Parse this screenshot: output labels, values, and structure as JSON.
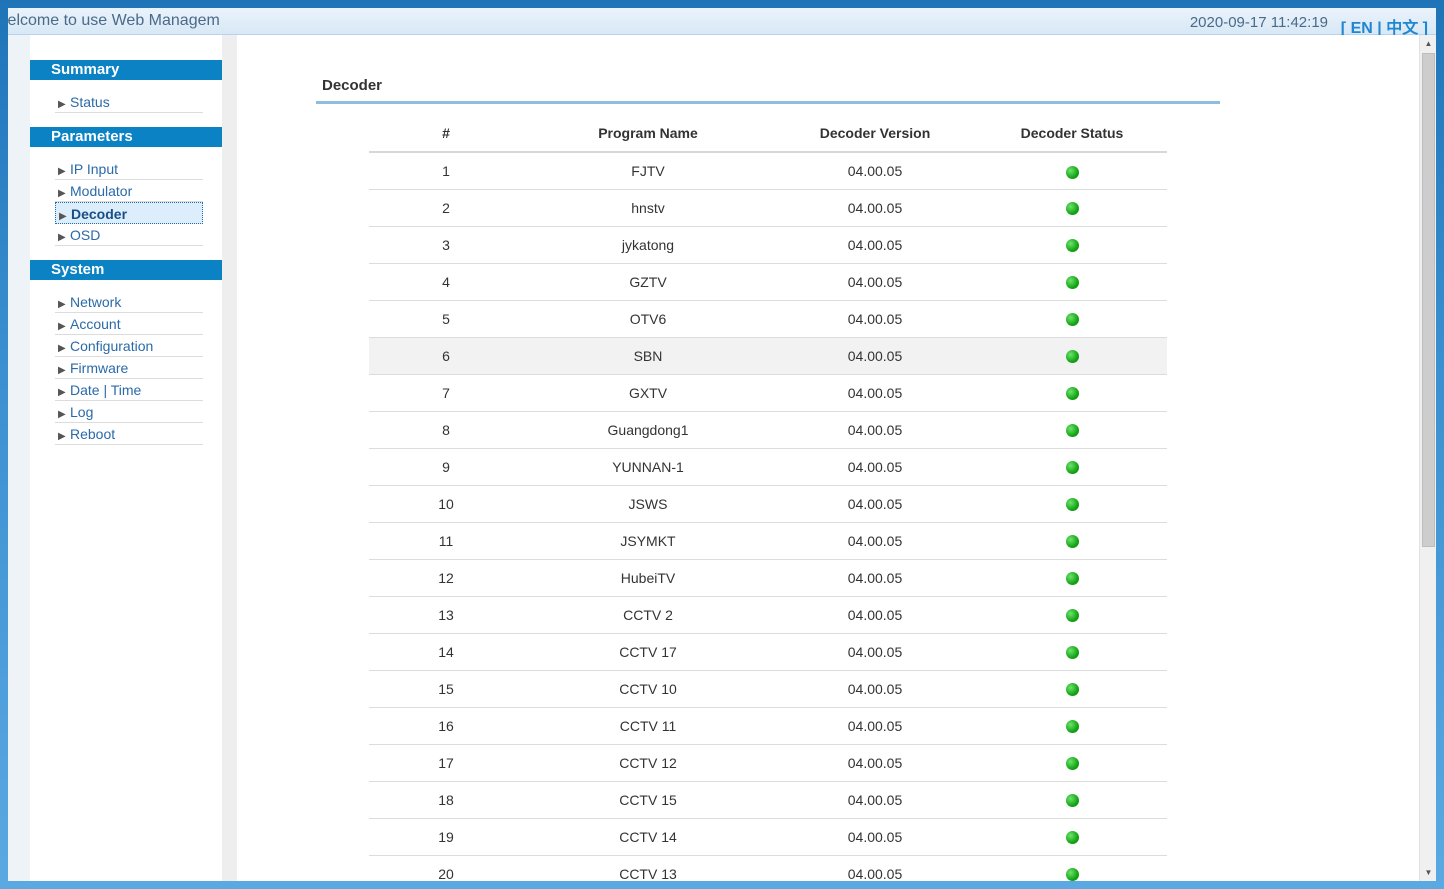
{
  "header": {
    "marquee_text": "welcome to use Web Management",
    "datetime": "2020-09-17 11:42:19",
    "lang_open": "[",
    "lang_en": "EN",
    "lang_sep": "|",
    "lang_cn": "中文",
    "lang_close": "]"
  },
  "sidebar": {
    "summary_title": "Summary",
    "summary_items": [
      "Status"
    ],
    "parameters_title": "Parameters",
    "parameters_items": [
      "IP Input",
      "Modulator",
      "Decoder",
      "OSD"
    ],
    "system_title": "System",
    "system_items": [
      "Network",
      "Account",
      "Configuration",
      "Firmware",
      "Date | Time",
      "Log",
      "Reboot"
    ],
    "active_item": "Decoder"
  },
  "panel": {
    "title": "Decoder",
    "columns": [
      "#",
      "Program Name",
      "Decoder Version",
      "Decoder Status"
    ],
    "rows": [
      {
        "num": "1",
        "name": "FJTV",
        "version": "04.00.05",
        "status": "ok"
      },
      {
        "num": "2",
        "name": "hnstv",
        "version": "04.00.05",
        "status": "ok"
      },
      {
        "num": "3",
        "name": "jykatong",
        "version": "04.00.05",
        "status": "ok"
      },
      {
        "num": "4",
        "name": "GZTV",
        "version": "04.00.05",
        "status": "ok"
      },
      {
        "num": "5",
        "name": "OTV6",
        "version": "04.00.05",
        "status": "ok"
      },
      {
        "num": "6",
        "name": "SBN",
        "version": "04.00.05",
        "status": "ok"
      },
      {
        "num": "7",
        "name": "GXTV",
        "version": "04.00.05",
        "status": "ok"
      },
      {
        "num": "8",
        "name": "Guangdong1",
        "version": "04.00.05",
        "status": "ok"
      },
      {
        "num": "9",
        "name": "YUNNAN-1",
        "version": "04.00.05",
        "status": "ok"
      },
      {
        "num": "10",
        "name": "JSWS",
        "version": "04.00.05",
        "status": "ok"
      },
      {
        "num": "11",
        "name": "JSYMKT",
        "version": "04.00.05",
        "status": "ok"
      },
      {
        "num": "12",
        "name": "HubeiTV",
        "version": "04.00.05",
        "status": "ok"
      },
      {
        "num": "13",
        "name": "CCTV 2",
        "version": "04.00.05",
        "status": "ok"
      },
      {
        "num": "14",
        "name": "CCTV 17",
        "version": "04.00.05",
        "status": "ok"
      },
      {
        "num": "15",
        "name": "CCTV 10",
        "version": "04.00.05",
        "status": "ok"
      },
      {
        "num": "16",
        "name": "CCTV 11",
        "version": "04.00.05",
        "status": "ok"
      },
      {
        "num": "17",
        "name": "CCTV 12",
        "version": "04.00.05",
        "status": "ok"
      },
      {
        "num": "18",
        "name": "CCTV 15",
        "version": "04.00.05",
        "status": "ok"
      },
      {
        "num": "19",
        "name": "CCTV 14",
        "version": "04.00.05",
        "status": "ok"
      },
      {
        "num": "20",
        "name": "CCTV 13",
        "version": "04.00.05",
        "status": "ok"
      }
    ],
    "highlighted_row": "6"
  },
  "colors": {
    "accent": "#0a82c4",
    "status_ok": "#14a514",
    "link": "#2a6aa8"
  },
  "icons": {
    "menu_arrow": "triangle-right-icon",
    "status_ok": "green-dot-icon",
    "scroll_up": "scroll-up-arrow-icon",
    "scroll_down": "scroll-down-arrow-icon"
  }
}
